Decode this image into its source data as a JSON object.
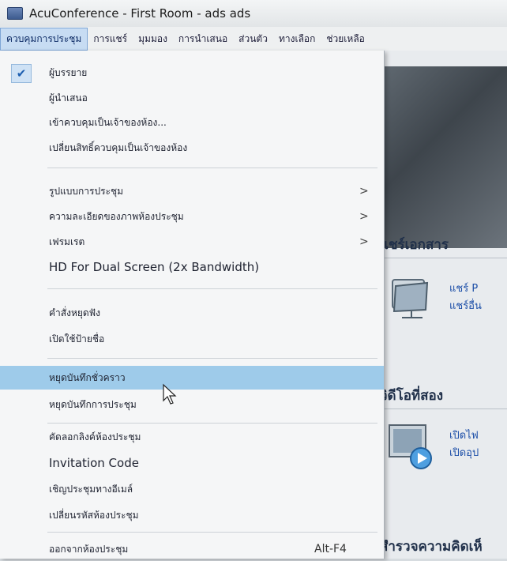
{
  "window": {
    "title": "AcuConference - First Room - ads ads"
  },
  "menubar": {
    "items": [
      "ควบคุมการประชุม",
      "การแชร์",
      "มุมมอง",
      "การนำเสนอ",
      "ส่วนตัว",
      "ทางเลือก",
      "ช่วยเหลือ"
    ]
  },
  "menu": {
    "items": [
      "ผู้บรรยาย",
      "ผู้นำเสนอ",
      "เข้าควบคุมเป็นเจ้าของห้อง...",
      "เปลี่ยนสิทธิ์ควบคุมเป็นเจ้าของห้อง",
      "รูปแบบการประชุม",
      "ความละเอียดของภาพห้องประชุม",
      "เฟรมเรต",
      "HD For Dual Screen (2x Bandwidth)",
      "คำสั่งหยุดฟัง",
      "เปิดใช้ป้ายชื่อ",
      "หยุดบันทึกชั่วคราว",
      "หยุดบันทึกการประชุม",
      "คัดลอกลิงค์ห้องประชุม",
      "Invitation Code",
      "เชิญประชุมทางอีเมล์",
      "เปลี่ยนรหัสห้องประชุม",
      "ออกจากห้องประชุม"
    ],
    "checked_mark": "✔",
    "submenu_arrow": ">",
    "exit_shortcut": "Alt-F4"
  },
  "panel": {
    "share_title": "แชร์เอกสาร",
    "share_link_1": "แชร์ P",
    "share_link_2": "แชร์อื่น",
    "video_title": "วิดีโอที่สอง",
    "video_link_1": "เปิดไฟ",
    "video_link_2": "เปิดอุป",
    "survey_title": "สำรวจความคิดเห็"
  },
  "icons": {
    "app": "app-icon",
    "folder": "folder-icon",
    "monitor": "monitor-play-icon",
    "cursor": "mouse-cursor-icon"
  },
  "colors": {
    "highlight": "#9ecbea",
    "active_menu": "#c7dcf3",
    "link": "#1d4fa8"
  }
}
